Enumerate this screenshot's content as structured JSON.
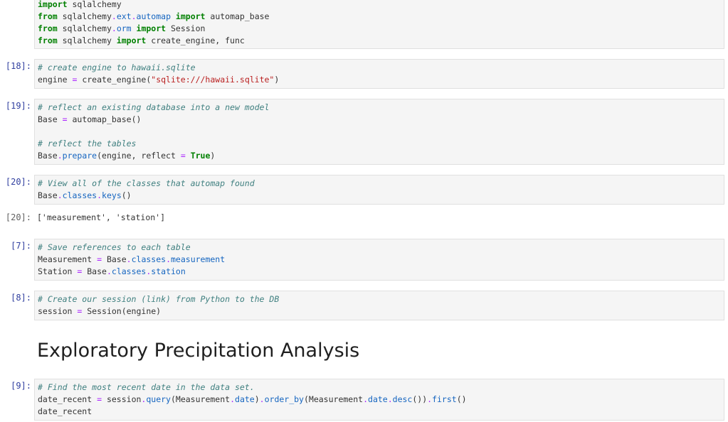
{
  "cells": {
    "imports": {
      "prompt": "",
      "lines": {
        "l1": {
          "kw": "import",
          "rest": " sqlalchemy"
        },
        "l2": {
          "kw1": "from",
          "mod_a": " sqlalchemy",
          "dot1": ".",
          "mod_b": "ext",
          "dot2": ".",
          "mod_c": "automap",
          "kw2": " import",
          "rest": " automap_base"
        },
        "l3": {
          "kw1": "from",
          "mod_a": " sqlalchemy",
          "dot1": ".",
          "mod_b": "orm",
          "kw2": " import",
          "rest": " Session"
        },
        "l4": {
          "kw1": "from",
          "mod_a": " sqlalchemy",
          "kw2": " import",
          "rest": " create_engine, func"
        }
      }
    },
    "c18": {
      "prompt": "[18]:",
      "comment": "# create engine to hawaii.sqlite",
      "line2": {
        "var": "engine",
        "eq": " = ",
        "fn": "create_engine(",
        "str": "\"sqlite:///hawaii.sqlite\"",
        "close": ")"
      }
    },
    "c19": {
      "prompt": "[19]:",
      "comment1": "# reflect an existing database into a new model",
      "line2": {
        "var": "Base",
        "eq": " = ",
        "fn": "automap_base()"
      },
      "comment2": "# reflect the tables",
      "line5": {
        "obj": "Base",
        "dot": ".",
        "attr": "prepare",
        "args": "(engine, reflect ",
        "eq": "=",
        "sp": " ",
        "val": "True",
        "close": ")"
      }
    },
    "c20": {
      "prompt": "[20]:",
      "comment": "# View all of the classes that automap found",
      "line2": {
        "obj": "Base",
        "dot1": ".",
        "attr1": "classes",
        "dot2": ".",
        "attr2": "keys",
        "close": "()"
      }
    },
    "c20out": {
      "prompt": "[20]:",
      "text": "['measurement', 'station']"
    },
    "c7": {
      "prompt": "[7]:",
      "comment": "# Save references to each table",
      "line2": {
        "var": "Measurement",
        "eq": " = ",
        "obj": "Base",
        "dot1": ".",
        "attr1": "classes",
        "dot2": ".",
        "attr2": "measurement"
      },
      "line3": {
        "var": "Station",
        "eq": " = ",
        "obj": "Base",
        "dot1": ".",
        "attr1": "classes",
        "dot2": ".",
        "attr2": "station"
      }
    },
    "c8": {
      "prompt": "[8]:",
      "comment": "# Create our session (link) from Python to the DB",
      "line2": {
        "var": "session",
        "eq": " = ",
        "fn": "Session(engine)"
      }
    },
    "heading": "Exploratory Precipitation Analysis",
    "c9": {
      "prompt": "[9]:",
      "comment": "# Find the most recent date in the data set.",
      "line2": {
        "var": "date_recent",
        "eq": " = ",
        "obj": "session",
        "d1": ".",
        "a1": "query",
        "p1": "(Measurement",
        "d2": ".",
        "a2": "date",
        "p2": ")",
        "d3": ".",
        "a3": "order_by",
        "p3": "(Measurement",
        "d4": ".",
        "a4": "date",
        "d5": ".",
        "a5": "desc",
        "p4": "())",
        "d6": ".",
        "a6": "first",
        "p5": "()"
      },
      "line3": "date_recent"
    }
  }
}
